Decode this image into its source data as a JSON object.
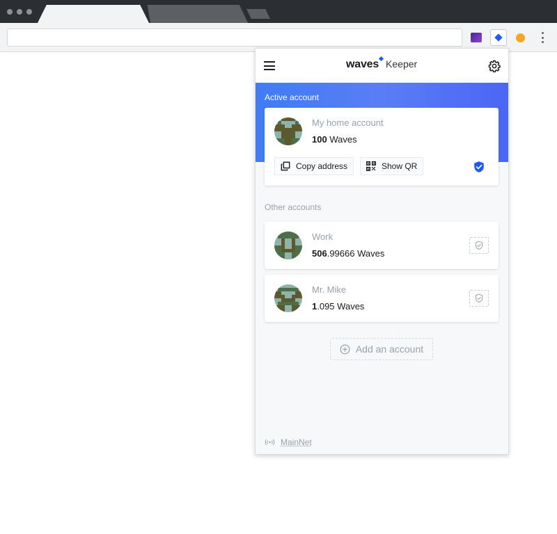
{
  "browser": {
    "tabs": [
      "",
      ""
    ]
  },
  "extensions": [
    "purple-extension",
    "waves-keeper-extension",
    "orange-extension"
  ],
  "popup": {
    "header": {
      "logo_word": "waves",
      "logo_suffix": "Keeper"
    },
    "active_section_label": "Active account",
    "active_account": {
      "name": "My home account",
      "balance_int": "100",
      "balance_frac": "",
      "unit": "Waves",
      "copy_label": "Copy address",
      "qr_label": "Show QR"
    },
    "other_section_label": "Other accounts",
    "other_accounts": [
      {
        "name": "Work",
        "balance_int": "506",
        "balance_frac": ".99666",
        "unit": "Waves"
      },
      {
        "name": "Mr. Mike",
        "balance_int": "1",
        "balance_frac": ".095",
        "unit": "Waves"
      }
    ],
    "add_account_label": "Add an account",
    "network_label": "MainNet"
  },
  "colors": {
    "accent": "#1f5af6",
    "hero_start": "#3f7cf4",
    "hero_end": "#4a66f5",
    "muted_text": "#9aa1ab",
    "avatar_dark": "#5a5a2e",
    "avatar_light": "#8fb3a8",
    "avatar_green": "#4e6e4a"
  }
}
